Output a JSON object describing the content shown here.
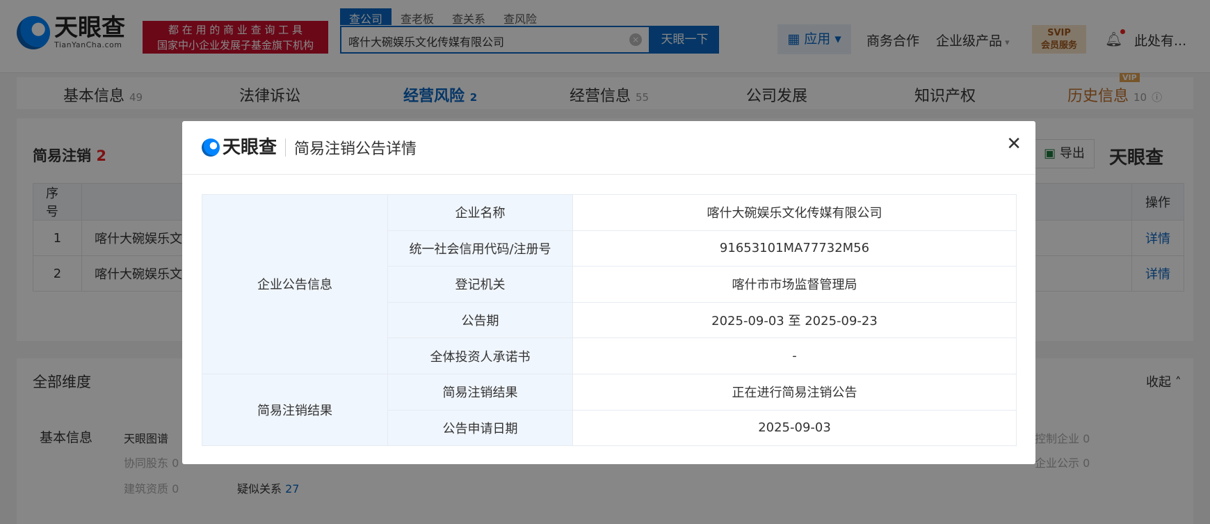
{
  "header": {
    "logo_text": "天眼查",
    "logo_sub": "TianYanCha.com",
    "banner_line1": "都 在 用 的 商 业 查 询 工 具",
    "banner_line2": "国家中小企业发展子基金旗下机构",
    "search_tabs": [
      "查公司",
      "查老板",
      "查关系",
      "查风险"
    ],
    "search_value": "喀什大碗娱乐文化传媒有限公司",
    "search_button": "天眼一下",
    "app_label": "应用",
    "nav": [
      "商务合作",
      "企业级产品"
    ],
    "svip_top": "SVIP",
    "svip_bottom": "会员服务",
    "user": "此处有..."
  },
  "tabs": [
    {
      "label": "基本信息",
      "count": "49"
    },
    {
      "label": "法律诉讼",
      "count": ""
    },
    {
      "label": "经营风险",
      "count": "2"
    },
    {
      "label": "经营信息",
      "count": "55"
    },
    {
      "label": "公司发展",
      "count": ""
    },
    {
      "label": "知识产权",
      "count": ""
    },
    {
      "label": "历史信息",
      "count": "10",
      "badge": "VIP"
    }
  ],
  "section": {
    "title": "简易注销",
    "count": "2",
    "export": "导出",
    "logo": "天眼查",
    "columns": [
      "序号",
      "操作"
    ],
    "rows": [
      {
        "no": "1",
        "name": "喀什大碗娱乐文",
        "action": "详情"
      },
      {
        "no": "2",
        "name": "喀什大碗娱乐文",
        "action": "详情"
      }
    ]
  },
  "dimensions": {
    "title": "全部维度",
    "collapse": "收起",
    "group": "基本信息",
    "items": [
      {
        "label": "天眼图谱",
        "count": ""
      },
      {
        "label": "协同股东",
        "count": "0"
      },
      {
        "label": "建筑资质",
        "count": "0"
      },
      {
        "label": "疑似关系",
        "count": "27"
      },
      {
        "label": "控制企业",
        "count": "0"
      },
      {
        "label": "企业公示",
        "count": "0"
      }
    ]
  },
  "modal": {
    "logo": "天眼查",
    "title": "简易注销公告详情",
    "group1": "企业公告信息",
    "group2": "简易注销结果",
    "rows": [
      {
        "label": "企业名称",
        "value": "喀什大碗娱乐文化传媒有限公司"
      },
      {
        "label": "统一社会信用代码/注册号",
        "value": "91653101MA77732M56"
      },
      {
        "label": "登记机关",
        "value": "喀什市市场监督管理局"
      },
      {
        "label": "公告期",
        "value": "2025-09-03 至 2025-09-23"
      },
      {
        "label": "全体投资人承诺书",
        "value": "-"
      },
      {
        "label": "简易注销结果",
        "value": "正在进行简易注销公告"
      },
      {
        "label": "公告申请日期",
        "value": "2025-09-03"
      }
    ]
  },
  "colors": {
    "brand": "#0a66c2",
    "danger": "#c8102e",
    "vip": "#c0702a"
  }
}
